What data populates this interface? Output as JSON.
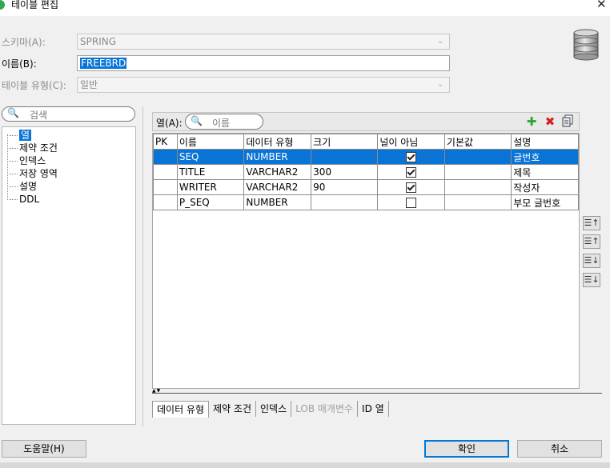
{
  "window": {
    "title": "테이블 편집",
    "close_glyph": "✕"
  },
  "form": {
    "schema_label": "스키마(A):",
    "schema_value": "SPRING",
    "name_label": "이름(B):",
    "name_value": "FREEBRD",
    "type_label": "테이블 유형(C):",
    "type_value": "일반"
  },
  "left": {
    "search_placeholder": "검색",
    "tree": [
      "열",
      "제약 조건",
      "인덱스",
      "저장 영역",
      "설명",
      "DDL"
    ]
  },
  "columns_panel": {
    "label": "열(A):",
    "filter_placeholder": "이름",
    "headers": [
      "PK",
      "이름",
      "데이터 유형",
      "크기",
      "널이 아님",
      "기본값",
      "설명"
    ],
    "rows": [
      {
        "pk": "",
        "name": "SEQ",
        "type": "NUMBER",
        "size": "",
        "not_null": true,
        "default": "",
        "comment": "글번호",
        "selected": true
      },
      {
        "pk": "",
        "name": "TITLE",
        "type": "VARCHAR2",
        "size": "300",
        "not_null": true,
        "default": "",
        "comment": "제목",
        "selected": false
      },
      {
        "pk": "",
        "name": "WRITER",
        "type": "VARCHAR2",
        "size": "90",
        "not_null": true,
        "default": "",
        "comment": "작성자",
        "selected": false
      },
      {
        "pk": "",
        "name": "P_SEQ",
        "type": "NUMBER",
        "size": "",
        "not_null": false,
        "default": "",
        "comment": "부모 글번호",
        "selected": false
      }
    ]
  },
  "tabs": [
    {
      "label": "데이터 유형",
      "state": "active"
    },
    {
      "label": "제약 조건",
      "state": "normal"
    },
    {
      "label": "인덱스",
      "state": "normal"
    },
    {
      "label": "LOB 매개변수",
      "state": "disabled"
    },
    {
      "label": "ID 열",
      "state": "normal"
    }
  ],
  "buttons": {
    "help": "도움말(H)",
    "ok": "확인",
    "cancel": "취소"
  },
  "colors": {
    "selection": "#0a74d6",
    "add_icon": "#2ea52e",
    "delete_icon": "#d42020"
  },
  "icons": [
    "database-icon",
    "search-icon",
    "add-icon",
    "delete-icon",
    "copy-icon",
    "move-top-icon",
    "move-up-icon",
    "move-down-icon",
    "move-bottom-icon"
  ]
}
